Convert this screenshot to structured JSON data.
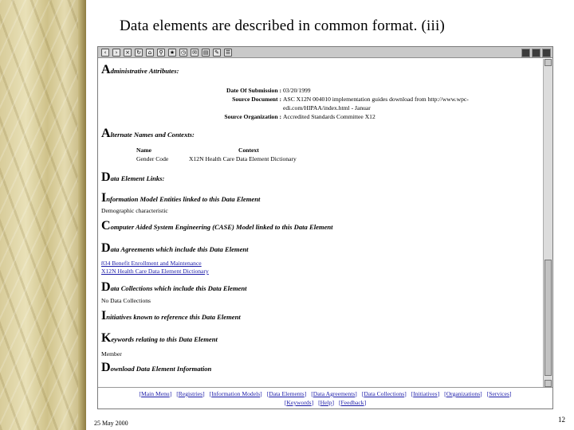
{
  "slide": {
    "title": "Data elements are described in common format. (iii)",
    "date": "25 May 2000",
    "page_number": "12"
  },
  "browser": {
    "toolbar_icons": [
      "back-icon",
      "forward-icon",
      "stop-icon",
      "refresh-icon",
      "home-icon",
      "search-icon",
      "favorites-icon",
      "history-icon",
      "mail-icon",
      "print-icon",
      "edit-icon",
      "discuss-icon"
    ]
  },
  "doc": {
    "admin": {
      "cap": "A",
      "rest": "dministrative Attributes:",
      "rows": [
        {
          "key": "Date Of Submission :",
          "value": "03/20/1999"
        },
        {
          "key": "Source Document :",
          "value": "ASC X12N 004010 implementation guides download from http://www.wpc-"
        },
        {
          "key": "",
          "value": "edi.com/HIPAA/index.html - Januar"
        },
        {
          "key": "Source Organization :",
          "value": "Accredited Standards Committee X12"
        }
      ]
    },
    "alt": {
      "cap": "A",
      "rest": "lternate Names and Contexts:",
      "col_name": "Name",
      "col_context": "Context",
      "row_name": "Gender Code",
      "row_context": "X12N Health Care Data Element Dictionary"
    },
    "links": {
      "cap": "D",
      "rest": "ata Element Links:"
    },
    "info": {
      "cap": "I",
      "rest": "nformation Model Entities linked to this Data Element",
      "item": "Demographic characteristic"
    },
    "case": {
      "cap": "C",
      "rest": "omputer Aided System Engineering (CASE) Model linked to this Data Element"
    },
    "agree": {
      "cap": "D",
      "rest": "ata Agreements which include this Data Element",
      "items": [
        "834 Benefit Enrollment and Maintenance",
        "X12N Health Care Data Element Dictionary"
      ]
    },
    "coll": {
      "cap": "D",
      "rest": "ata Collections which include this Data Element",
      "item": "No Data Collections"
    },
    "init": {
      "cap": "I",
      "rest": "nitiatives known to reference this Data Element"
    },
    "kw": {
      "cap": "K",
      "rest": "eywords relating to this Data Element",
      "item": "Member"
    },
    "dl": {
      "cap": "D",
      "rest": "ownload Data Element Information"
    }
  },
  "nav": {
    "row1": [
      "Main Menu",
      "Registries",
      "Information Models",
      "Data Elements",
      "Data Agreements",
      "Data Collections",
      "Initiatives",
      "Organizations",
      "Services"
    ],
    "row2": [
      "Keywords",
      "Help",
      "Feedback"
    ]
  }
}
